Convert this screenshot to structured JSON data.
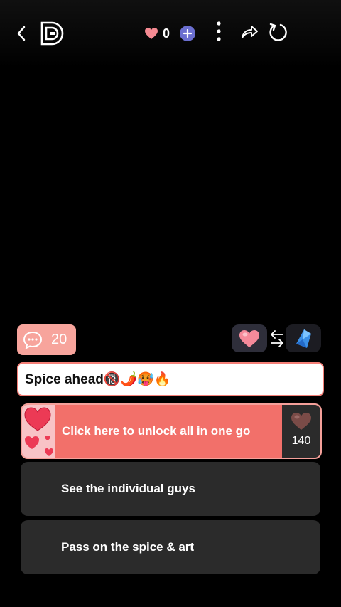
{
  "header": {
    "back_icon": "chevron-left-icon",
    "logo_icon": "dd-logo-icon",
    "heart_count": "0",
    "plus_icon": "plus-icon",
    "more_icon": "more-vertical-icon",
    "share_icon": "share-arrow-icon",
    "refresh_icon": "refresh-icon"
  },
  "comments": {
    "count": "20"
  },
  "currency": {
    "heart_icon": "heart-icon",
    "swap_icon": "swap-arrows-icon",
    "gem_icon": "gem-icon"
  },
  "message": {
    "text": "Spice ahead🔞🌶️🥵🔥"
  },
  "choices": {
    "unlock": {
      "label": "Click here to unlock all in one go",
      "price": "140"
    },
    "individual": {
      "label": "See the individual guys"
    },
    "pass": {
      "label": "Pass on the spice & art"
    }
  },
  "colors": {
    "accent": "#f2706a",
    "comment_bg": "#f7a49c",
    "option_bg": "#2b2b2b",
    "plus": "#6b6fd0"
  }
}
